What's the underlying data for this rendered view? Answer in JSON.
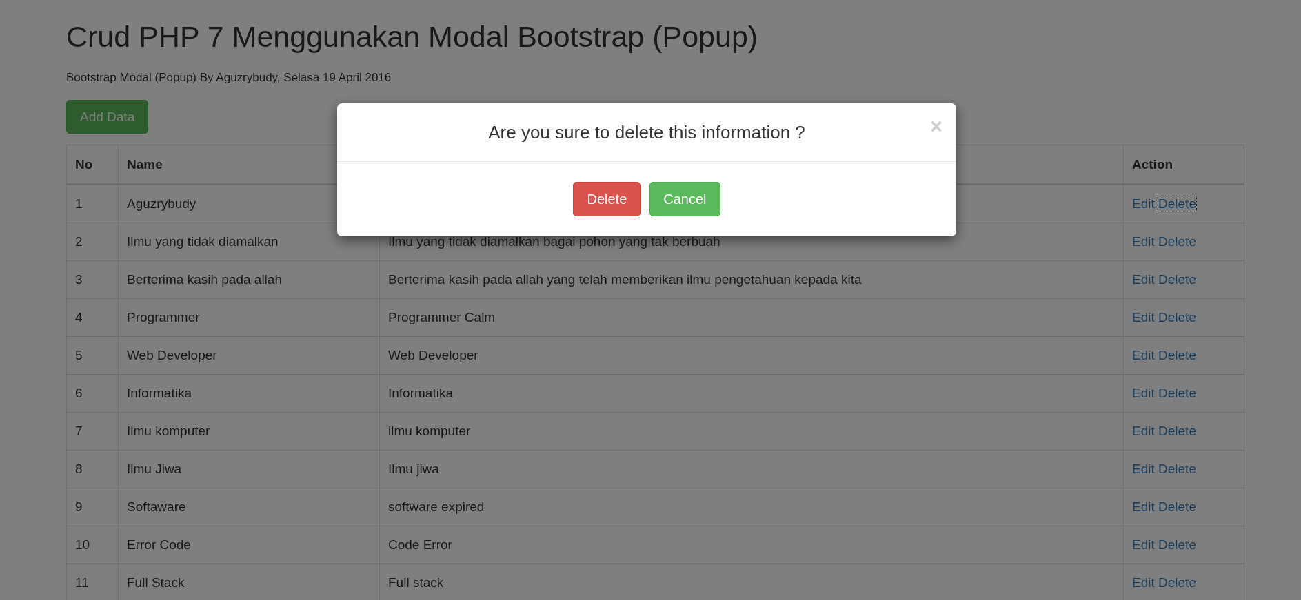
{
  "page": {
    "title": "Crud PHP 7 Menggunakan Modal Bootstrap (Popup)",
    "subtitle": "Bootstrap Modal (Popup) By Aguzrybudy, Selasa 19 April 2016",
    "add_button": "Add Data"
  },
  "table": {
    "columns": {
      "no": "No",
      "name": "Name",
      "action": "Action"
    },
    "rows": [
      {
        "no": "1",
        "name": "Aguzrybudy",
        "edit": "Edit",
        "delete": "Delete",
        "focused": true
      },
      {
        "no": "2",
        "name": "Ilmu yang tidak diamalkan",
        "description": "Ilmu yang tidak diamalkan bagai pohon yang tak berbuah",
        "edit": "Edit",
        "delete": "Delete",
        "focused": false
      },
      {
        "no": "3",
        "name": "Berterima kasih pada allah",
        "description": "Berterima kasih pada allah yang telah memberikan ilmu pengetahuan kepada kita",
        "edit": "Edit",
        "delete": "Delete",
        "focused": false
      },
      {
        "no": "4",
        "name": "Programmer",
        "description": "Programmer Calm",
        "edit": "Edit",
        "delete": "Delete",
        "focused": false
      },
      {
        "no": "5",
        "name": "Web Developer",
        "description": "Web Developer",
        "edit": "Edit",
        "delete": "Delete",
        "focused": false
      },
      {
        "no": "6",
        "name": "Informatika",
        "description": "Informatika",
        "edit": "Edit",
        "delete": "Delete",
        "focused": false
      },
      {
        "no": "7",
        "name": "Ilmu komputer",
        "description": "ilmu komputer",
        "edit": "Edit",
        "delete": "Delete",
        "focused": false
      },
      {
        "no": "8",
        "name": "Ilmu Jiwa",
        "description": "Ilmu jiwa",
        "edit": "Edit",
        "delete": "Delete",
        "focused": false
      },
      {
        "no": "9",
        "name": "Softaware",
        "description": "software expired",
        "edit": "Edit",
        "delete": "Delete",
        "focused": false
      },
      {
        "no": "10",
        "name": "Error Code",
        "description": "Code Error",
        "edit": "Edit",
        "delete": "Delete",
        "focused": false
      },
      {
        "no": "11",
        "name": "Full Stack",
        "description": "Full stack",
        "edit": "Edit",
        "delete": "Delete",
        "focused": false
      }
    ]
  },
  "modal": {
    "title": "Are you sure to delete this information ?",
    "close": "×",
    "buttons": [
      {
        "label": "Delete",
        "kind": "danger"
      },
      {
        "label": "Cancel",
        "kind": "success"
      }
    ]
  }
}
